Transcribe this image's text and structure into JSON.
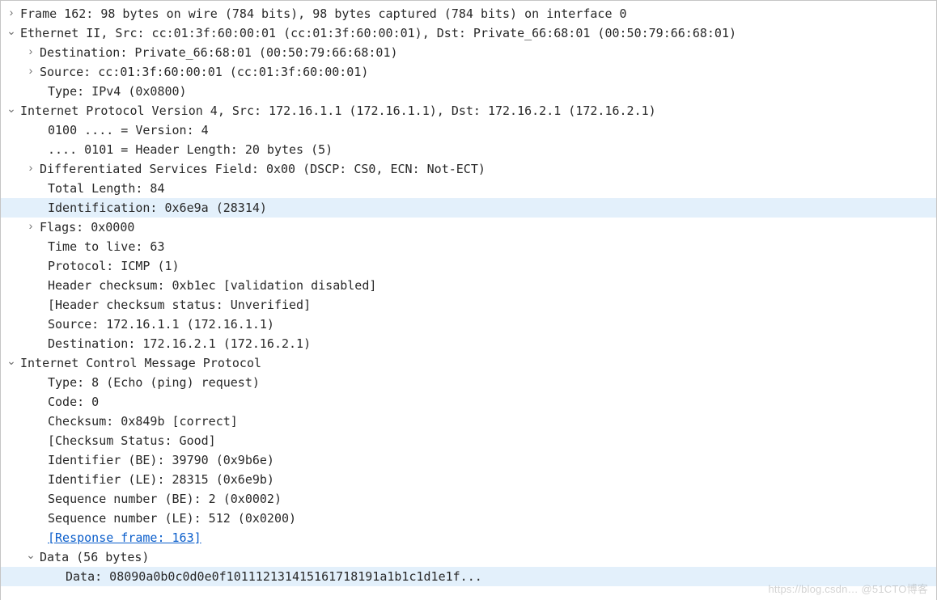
{
  "frame": {
    "summary": "Frame 162: 98 bytes on wire (784 bits), 98 bytes captured (784 bits) on interface 0"
  },
  "ethernet": {
    "summary": "Ethernet II, Src: cc:01:3f:60:00:01 (cc:01:3f:60:00:01), Dst: Private_66:68:01 (00:50:79:66:68:01)",
    "destination": "Destination: Private_66:68:01 (00:50:79:66:68:01)",
    "source": "Source: cc:01:3f:60:00:01 (cc:01:3f:60:00:01)",
    "type": "Type: IPv4 (0x0800)"
  },
  "ip": {
    "summary": "Internet Protocol Version 4, Src: 172.16.1.1 (172.16.1.1), Dst: 172.16.2.1 (172.16.2.1)",
    "version": "0100 .... = Version: 4",
    "hdr_len": ".... 0101 = Header Length: 20 bytes (5)",
    "dsfield": "Differentiated Services Field: 0x00 (DSCP: CS0, ECN: Not-ECT)",
    "total_len": "Total Length: 84",
    "identification": "Identification: 0x6e9a (28314)",
    "flags": "Flags: 0x0000",
    "ttl": "Time to live: 63",
    "protocol": "Protocol: ICMP (1)",
    "checksum": "Header checksum: 0xb1ec [validation disabled]",
    "checksum_status": "[Header checksum status: Unverified]",
    "src": "Source: 172.16.1.1 (172.16.1.1)",
    "dst": "Destination: 172.16.2.1 (172.16.2.1)"
  },
  "icmp": {
    "summary": "Internet Control Message Protocol",
    "type": "Type: 8 (Echo (ping) request)",
    "code": "Code: 0",
    "checksum": "Checksum: 0x849b [correct]",
    "checksum_status": "[Checksum Status: Good]",
    "id_be": "Identifier (BE): 39790 (0x9b6e)",
    "id_le": "Identifier (LE): 28315 (0x6e9b)",
    "seq_be": "Sequence number (BE): 2 (0x0002)",
    "seq_le": "Sequence number (LE): 512 (0x0200)",
    "response_frame": "[Response frame: 163]",
    "data_summary": "Data (56 bytes)",
    "data_bytes": "Data: 08090a0b0c0d0e0f101112131415161718191a1b1c1d1e1f..."
  },
  "watermark": "https://blog.csdn… @51CTO博客"
}
